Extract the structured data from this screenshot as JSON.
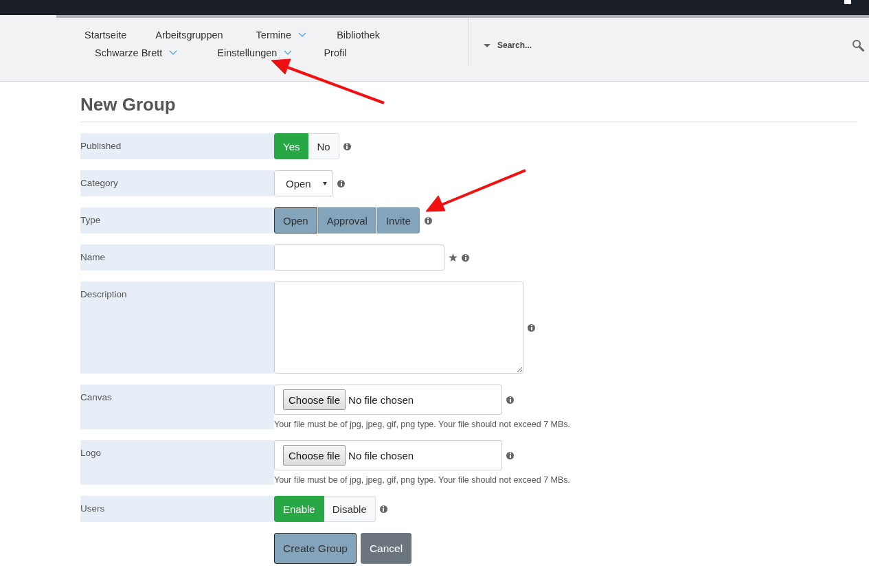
{
  "nav": {
    "items": [
      {
        "label": "Startseite",
        "dropdown": false
      },
      {
        "label": "Arbeitsgruppen",
        "dropdown": false
      },
      {
        "label": "Termine",
        "dropdown": true
      },
      {
        "label": "Bibliothek",
        "dropdown": false
      },
      {
        "label": "Schwarze Brett",
        "dropdown": true
      },
      {
        "label": "Einstellungen",
        "dropdown": true
      },
      {
        "label": "Profil",
        "dropdown": false
      }
    ]
  },
  "search": {
    "placeholder": "Search..."
  },
  "page_title": "New Group",
  "fields": [
    {
      "kind": "toggle",
      "label": "Published",
      "options": [
        {
          "label": "Yes",
          "selected": true
        },
        {
          "label": "No",
          "selected": false
        }
      ]
    },
    {
      "kind": "select",
      "label": "Category",
      "value": "Open"
    },
    {
      "kind": "segmented",
      "label": "Type",
      "options": [
        {
          "label": "Open",
          "selected": true
        },
        {
          "label": "Approval",
          "selected": false
        },
        {
          "label": "Invite",
          "selected": false
        }
      ]
    },
    {
      "kind": "text",
      "label": "Name",
      "required": true
    },
    {
      "kind": "textarea",
      "label": "Description"
    },
    {
      "kind": "file",
      "label": "Canvas",
      "button": "Choose file",
      "status": "No file chosen",
      "hint": "Your file must be of jpg, jpeg, gif, png type. Your file should not exceed 7 MBs."
    },
    {
      "kind": "file",
      "label": "Logo",
      "button": "Choose file",
      "status": "No file chosen",
      "hint": "Your file must be of jpg, jpeg, gif, png type. Your file should not exceed 7 MBs."
    },
    {
      "kind": "toggle",
      "label": "Users",
      "options": [
        {
          "label": "Enable",
          "selected": true
        },
        {
          "label": "Disable",
          "selected": false
        }
      ]
    }
  ],
  "buttons": [
    {
      "label": "Create Group",
      "kind": "primary"
    },
    {
      "label": "Cancel",
      "kind": "secondary"
    }
  ]
}
